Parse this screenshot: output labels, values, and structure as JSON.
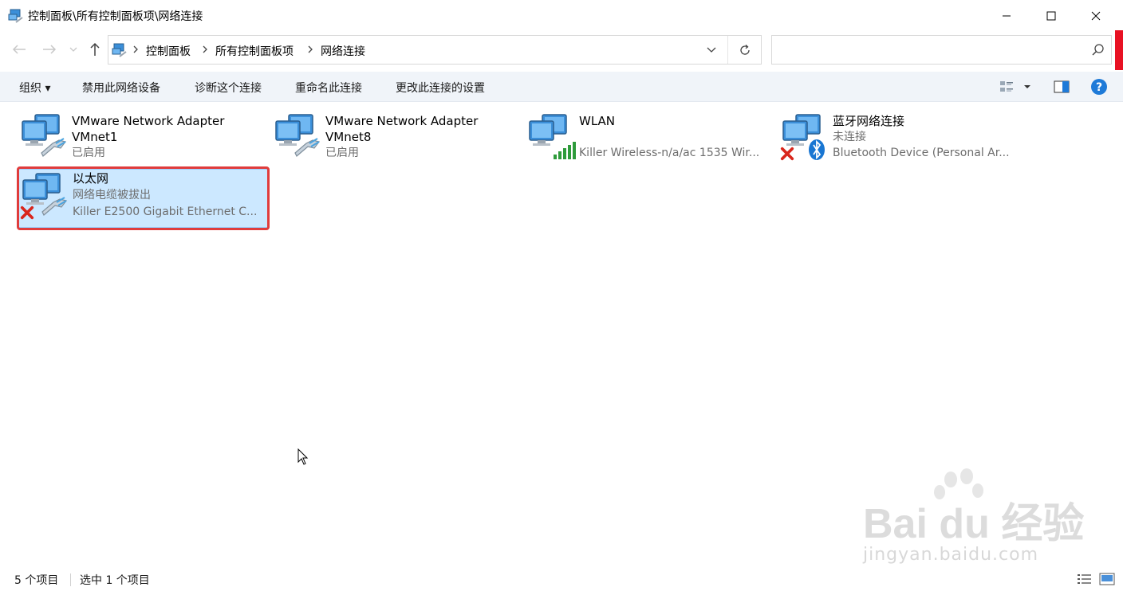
{
  "window": {
    "title": "控制面板\\所有控制面板项\\网络连接"
  },
  "address": {
    "crumbs": [
      "控制面板",
      "所有控制面板项",
      "网络连接"
    ]
  },
  "search": {
    "value": "",
    "placeholder": ""
  },
  "toolbar": {
    "organize": "组织 ▾",
    "disable": "禁用此网络设备",
    "diagnose": "诊断这个连接",
    "rename": "重命名此连接",
    "change_settings": "更改此连接的设置"
  },
  "connections": [
    {
      "name": "VMware Network Adapter VMnet1",
      "status": "已启用",
      "device": "",
      "icon": "network-adapter-icon"
    },
    {
      "name": "VMware Network Adapter VMnet8",
      "status": "已启用",
      "device": "",
      "icon": "network-adapter-icon"
    },
    {
      "name": "WLAN",
      "status": "",
      "device": "Killer Wireless-n/a/ac 1535 Wir...",
      "icon": "wlan-adapter-icon"
    },
    {
      "name": "蓝牙网络连接",
      "status": "未连接",
      "device": "Bluetooth Device (Personal Ar...",
      "icon": "bluetooth-adapter-icon"
    },
    {
      "name": "以太网",
      "status": "网络电缆被拔出",
      "device": "Killer E2500 Gigabit Ethernet C...",
      "icon": "ethernet-adapter-icon",
      "selected": true
    }
  ],
  "statusbar": {
    "count": "5 个项目",
    "selected": "选中 1 个项目"
  },
  "watermark": {
    "brand": "Bai du 经验",
    "url": "jingyan.baidu.com"
  },
  "colors": {
    "selection_bg": "#cce8ff",
    "highlight_border": "#e03c3c",
    "command_bar_bg": "#f0f4f9",
    "help_blue": "#1e7ad8"
  }
}
